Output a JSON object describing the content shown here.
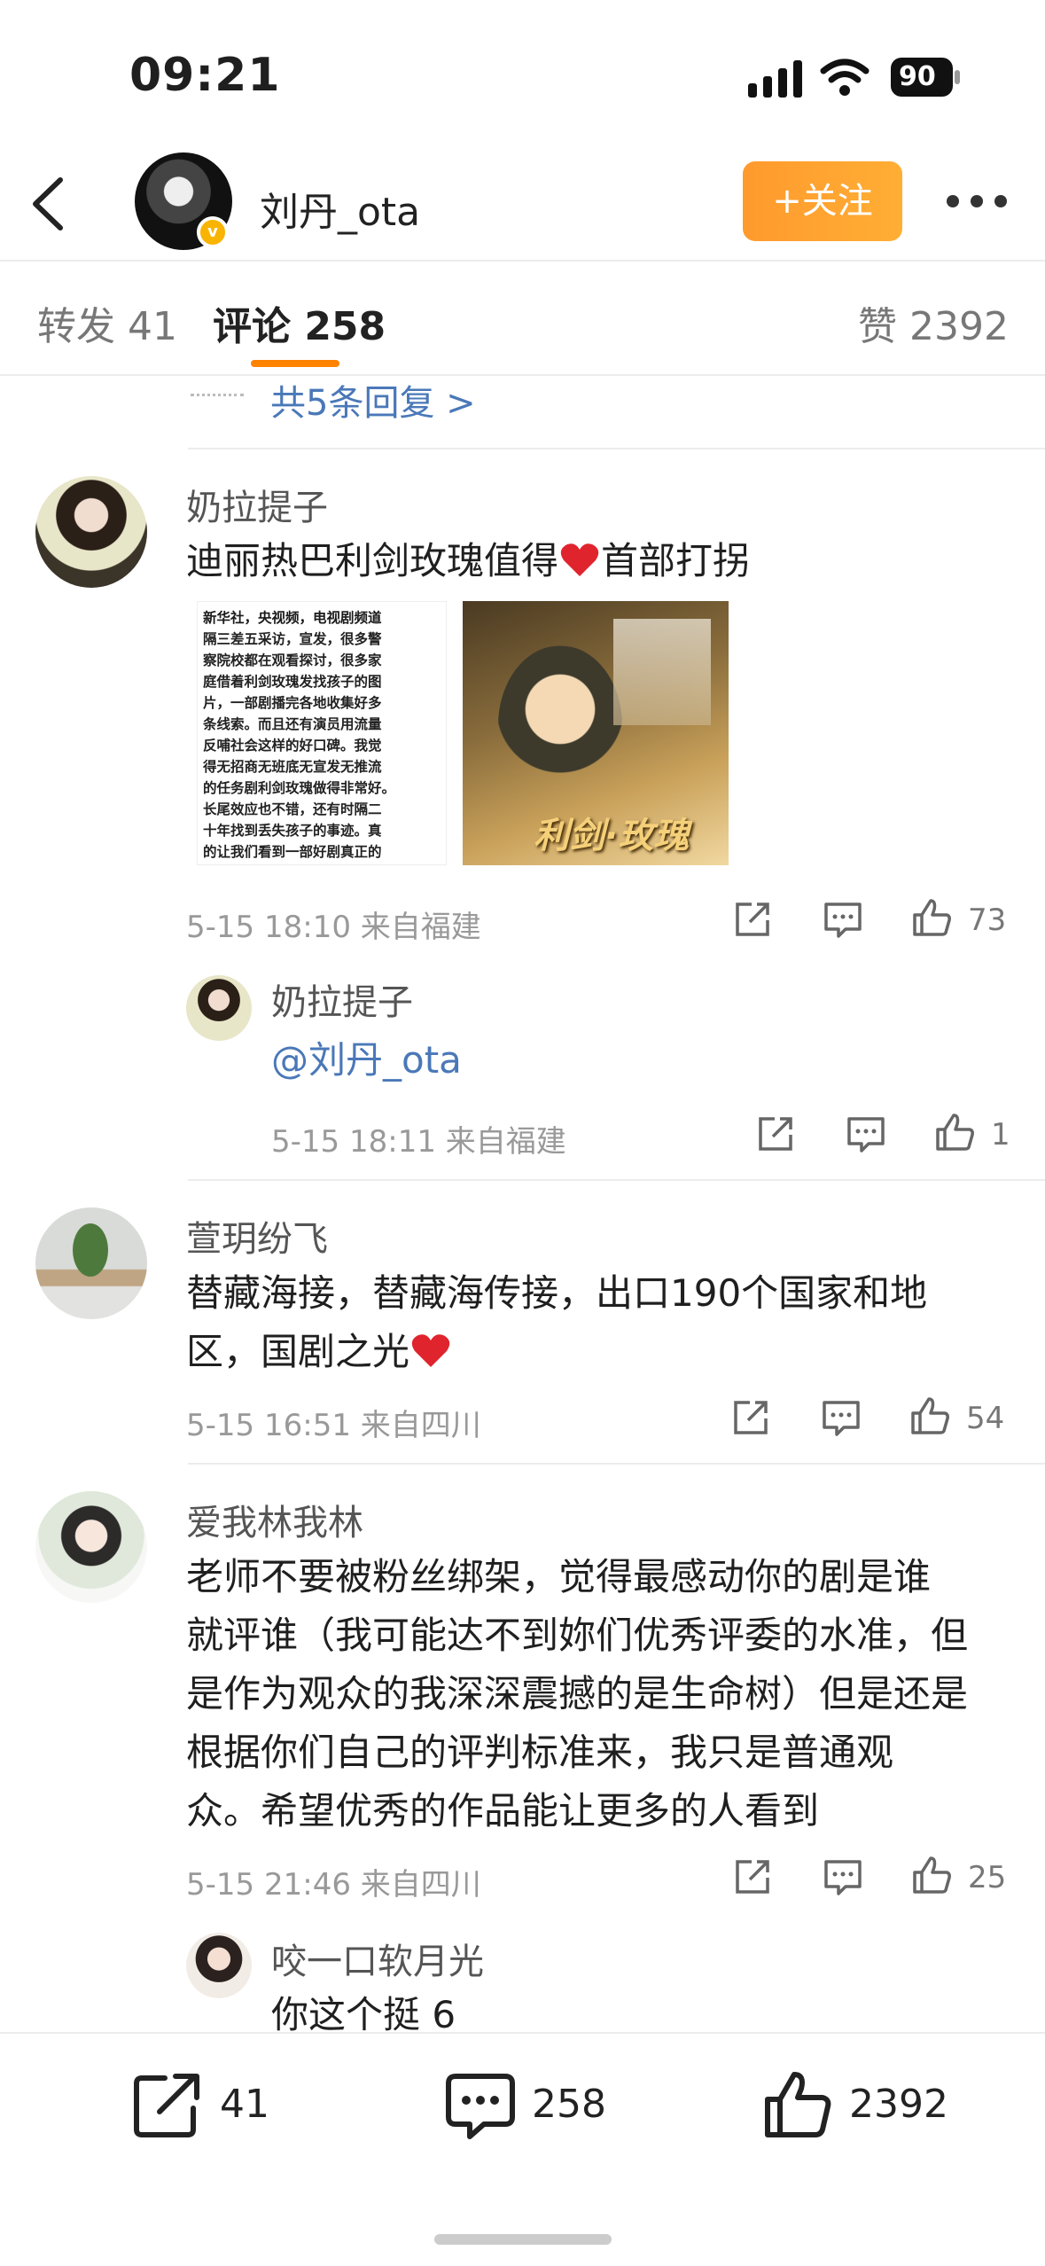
{
  "status": {
    "time": "09:21",
    "battery": "90"
  },
  "header": {
    "username": "刘丹_ota",
    "follow_label": "+关注",
    "verified_badge": "v"
  },
  "tabs": {
    "repost": "转发 41",
    "comment": "评论 258",
    "like": "赞 2392"
  },
  "replies_link": "共5条回复 >",
  "comments": [
    {
      "name": "奶拉提子",
      "text": "迪丽热巴利剑玫瑰值得",
      "text_after_heart": "首部打拐",
      "time": "5-15 18:10  来自福建",
      "likes": "73"
    },
    {
      "name": "萱玥纷飞",
      "text_line1": "替藏海接，替藏海传接，出口190个国家和地",
      "text_line2": "区，国剧之光",
      "time": "5-15 16:51  来自四川",
      "likes": "54"
    },
    {
      "name": "爱我林我林",
      "lines": [
        "老师不要被粉丝绑架，觉得最感动你的剧是谁",
        "就评谁（我可能达不到妳们优秀评委的水准，但",
        "是作为观众的我深深震撼的是生命树）但是还是",
        "根据你们自己的评判标准来，我只是普通观",
        "众。希望优秀的作品能让更多的人看到"
      ],
      "time": "5-15 21:46  来自四川",
      "likes": "25"
    }
  ],
  "sub_replies": [
    {
      "name": "奶拉提子",
      "text": "@刘丹_ota",
      "time": "5-15 18:11  来自福建",
      "likes": "1"
    },
    {
      "name": "咬一口软月光",
      "text": "你这个挺 6"
    }
  ],
  "news_image_lines": [
    "新华社，央视频，电视剧频道",
    "隔三差五采访，宣发，很多警",
    "察院校都在观看探讨，很多家",
    "庭借着利剑玫瑰发找孩子的图",
    "片，一部剧播完各地收集好多",
    "条线索。而且还有演员用流量",
    "反哺社会这样的好口碑。我觉",
    "得无招商无班底无宣发无推流",
    "的任务剧利剑玫瑰做得非常好。",
    "长尾效应也不错，还有时隔二",
    "十年找到丢失孩子的事迹。真",
    "的让我们看到一部好剧真正的"
  ],
  "poster_title": "利剑·玫瑰",
  "bottom_bar": {
    "repost": "41",
    "comment": "258",
    "like": "2392"
  },
  "colors": {
    "accent": "#ff8200",
    "link": "#4a78b8",
    "heart": "#e0242d"
  }
}
